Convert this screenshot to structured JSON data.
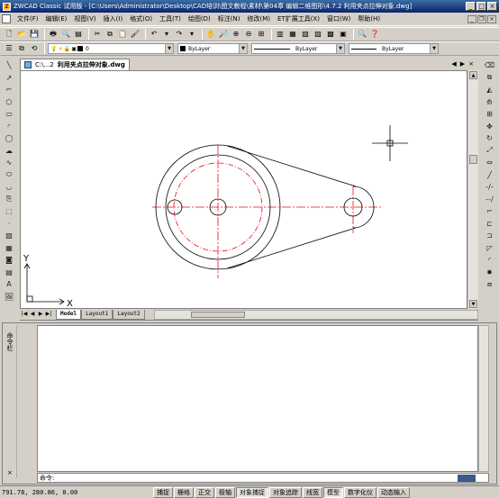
{
  "window": {
    "title": "ZWCAD Classic 试用版 - [C:\\Users\\Administrator\\Desktop\\CAD培训\\图文教程\\素材\\第04章 编辑二维图形\\4.7.2   利用夹点拉伸对象.dwg]",
    "app_icon": "Z",
    "minimize": "_",
    "maximize": "□",
    "close": "×"
  },
  "menu": {
    "items": [
      "文件(F)",
      "编辑(E)",
      "视图(V)",
      "插入(I)",
      "格式(O)",
      "工具(T)",
      "绘图(D)",
      "标注(N)",
      "修改(M)",
      "ET扩展工具(X)",
      "窗口(W)",
      "帮助(H)"
    ],
    "doc_minimize": "_",
    "doc_restore": "❐",
    "doc_close": "×"
  },
  "toolbar_layers": {
    "layer_name": "0",
    "color": "ByLayer",
    "linetype": "ByLayer",
    "lineweight": "ByLayer"
  },
  "document": {
    "tab_short": "C:\\...2",
    "tab_file": "利用夹点拉伸对象.dwg",
    "nav_prev": "◀",
    "nav_next": "▶",
    "nav_close": "×"
  },
  "ucs": {
    "x_label": "X",
    "y_label": "Y"
  },
  "layout_tabs": [
    "Model",
    "Layout1",
    "Layout2"
  ],
  "command": {
    "panel_title": "命令栏",
    "close": "×",
    "prompt": "命令:"
  },
  "status": {
    "coords": "791.78, 280.86, 0.00",
    "buttons": [
      {
        "label": "捕捉",
        "on": false
      },
      {
        "label": "栅格",
        "on": false
      },
      {
        "label": "正交",
        "on": false
      },
      {
        "label": "极轴",
        "on": false
      },
      {
        "label": "对象捕捉",
        "on": true
      },
      {
        "label": "对象追踪",
        "on": false
      },
      {
        "label": "线宽",
        "on": false
      },
      {
        "label": "模型",
        "on": true
      },
      {
        "label": "数字化仪",
        "on": false
      },
      {
        "label": "动态输入",
        "on": false
      }
    ]
  },
  "colors": {
    "title_bar": "#0a246a",
    "center_line": "#e8101a",
    "geometry": "#000000",
    "canvas": "#ffffff"
  }
}
